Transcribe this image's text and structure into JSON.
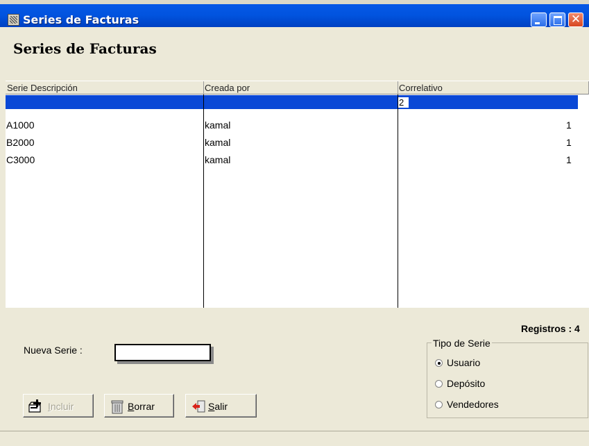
{
  "window": {
    "title": "Series de Facturas",
    "close_glyph": "✕"
  },
  "form": {
    "title": "Series de Facturas"
  },
  "grid": {
    "columns": [
      "Serie Descripción",
      "Creada por",
      "Correlativo"
    ],
    "selected_row": {
      "serie": "",
      "creada_por": "",
      "correlativo": "2"
    },
    "rows": [
      {
        "serie": "A1000",
        "creada_por": "kamal",
        "correlativo": "1"
      },
      {
        "serie": "B2000",
        "creada_por": "kamal",
        "correlativo": "1"
      },
      {
        "serie": "C3000",
        "creada_por": "kamal",
        "correlativo": "1"
      }
    ]
  },
  "registros": "Registros : 4",
  "nueva_serie": {
    "label": "Nueva Serie :",
    "value": ""
  },
  "buttons": {
    "incluir": {
      "label": "ncluir",
      "accel": "I",
      "enabled": false
    },
    "borrar": {
      "label": "orrar",
      "accel": "B"
    },
    "salir": {
      "label": "alir",
      "accel": "S"
    }
  },
  "tipo_de_serie": {
    "title": "Tipo de Serie",
    "options": [
      {
        "label": "Usuario",
        "selected": true
      },
      {
        "label": "Depósito",
        "selected": false
      },
      {
        "label": "Vendedores",
        "selected": false
      }
    ]
  },
  "colors": {
    "titlebar": "#0054e3",
    "selection": "#0a48d6",
    "face": "#ece9d8"
  },
  "icons": [
    "app-icon",
    "minimize-icon",
    "maximize-icon",
    "close-icon",
    "add-record-icon",
    "trash-icon",
    "exit-icon"
  ]
}
